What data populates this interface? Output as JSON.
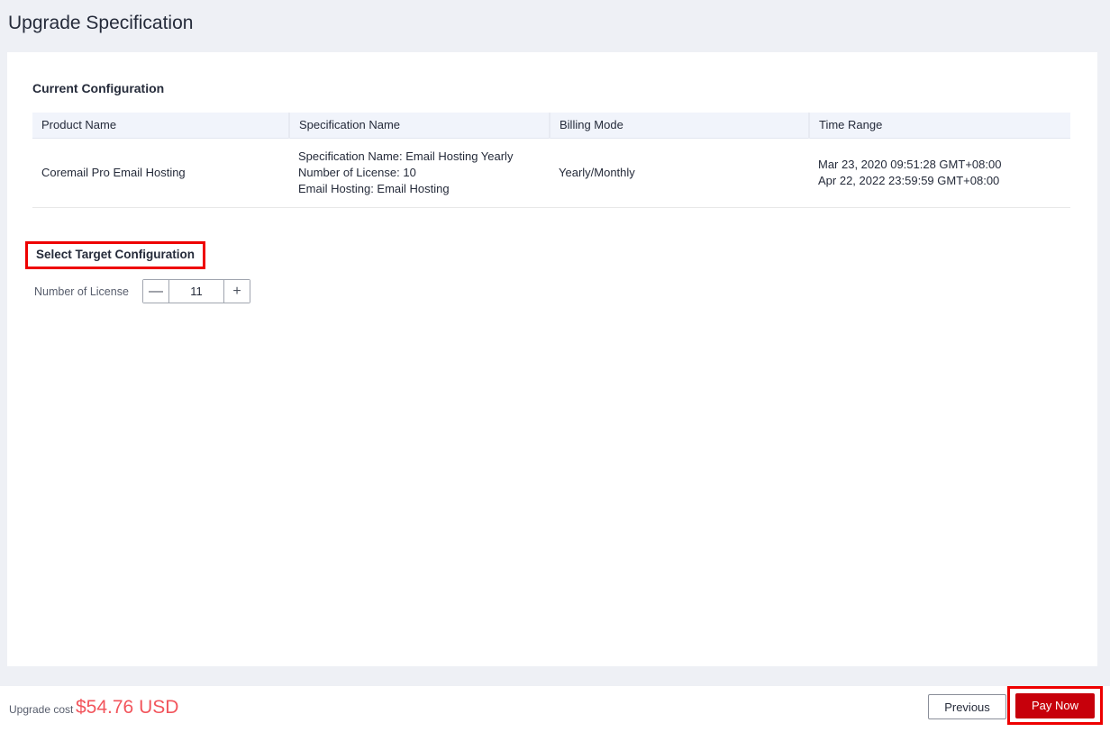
{
  "page_title": "Upgrade Specification",
  "colors": {
    "page_background": "#eef0f5",
    "card_background": "#ffffff",
    "table_header_background": "#f1f4fb",
    "annotation_red": "#ee0000",
    "pay_now_red": "#c7000b",
    "price_red": "#f2555c",
    "text_primary": "#252b3a",
    "text_secondary": "#575d6c"
  },
  "current_configuration": {
    "heading": "Current Configuration",
    "table": {
      "columns": [
        "Product Name",
        "Specification Name",
        "Billing Mode",
        "Time Range"
      ],
      "row": {
        "product_name": "Coremail Pro Email Hosting",
        "specification_lines": [
          "Specification Name: Email Hosting Yearly",
          "Number of License: 10",
          "Email Hosting: Email Hosting"
        ],
        "billing_mode": "Yearly/Monthly",
        "time_range_lines": [
          "Mar 23, 2020 09:51:28 GMT+08:00",
          "Apr 22, 2022 23:59:59 GMT+08:00"
        ]
      }
    }
  },
  "target_configuration": {
    "heading": "Select Target Configuration",
    "license_label": "Number of License",
    "license_value": "11",
    "minus_glyph": "—",
    "plus_glyph": "+"
  },
  "footer": {
    "cost_label": "Upgrade cost",
    "cost_value": "$54.76 USD",
    "previous_label": "Previous",
    "pay_now_label": "Pay Now"
  }
}
